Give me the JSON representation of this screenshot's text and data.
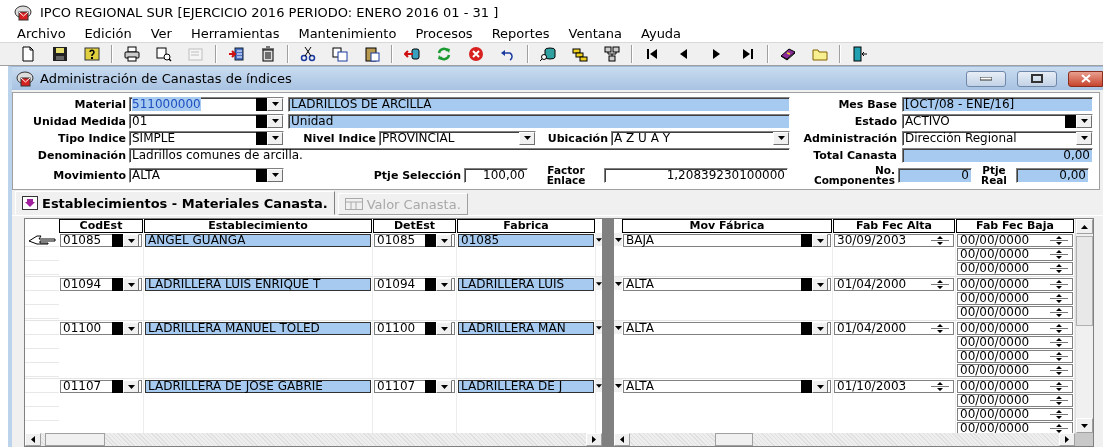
{
  "app_title": "IPCO REGIONAL SUR [EJERCICIO 2016 PERIODO: ENERO 2016 01 - 31 ]",
  "menu": [
    "Archivo",
    "Edición",
    "Ver",
    "Herramientas",
    "Mantenimiento",
    "Procesos",
    "Reportes",
    "Ventana",
    "Ayuda"
  ],
  "child_window": {
    "title": "Administración de Canastas de índices"
  },
  "form": {
    "material": {
      "label": "Material",
      "value": "511000000",
      "focused": true,
      "description": "LADRILLOS DE ARCILLA"
    },
    "unidad_medida": {
      "label": "Unidad Medida",
      "value": "01",
      "description": "Unidad"
    },
    "tipo_indice": {
      "label": "Tipo Indice",
      "value": "SIMPLE"
    },
    "nivel_indice": {
      "label": "Nivel Indice",
      "value": "PROVINCIAL"
    },
    "ubicacion": {
      "label": "Ubicación",
      "value": "A Z U A Y"
    },
    "denominacion": {
      "label": "Denominación",
      "value": "Ladrillos comunes de arcilla."
    },
    "movimiento": {
      "label": "Movimiento",
      "value": "ALTA"
    },
    "ptje_seleccion": {
      "label": "Ptje Selección",
      "value": "100,00"
    },
    "factor_enlace": {
      "label": "Factor Enlace",
      "value": "1,20839230100000"
    },
    "mes_base": {
      "label": "Mes Base",
      "value": "[OCT/08 - ENE/16]"
    },
    "estado": {
      "label": "Estado",
      "value": "ACTIVO"
    },
    "administracion": {
      "label": "Administración",
      "value": "Dirección Regional"
    },
    "total_canasta": {
      "label": "Total Canasta",
      "value": "0,00"
    },
    "no_componentes": {
      "label": "No. Componentes",
      "value": "0"
    },
    "ptje_real": {
      "label": "Ptje Real",
      "value": "0,00"
    }
  },
  "tabs": [
    {
      "label": "Establecimientos - Materiales Canasta.",
      "selected": true,
      "disabled": false
    },
    {
      "label": "Valor Canasta.",
      "selected": false,
      "disabled": true
    }
  ],
  "grid": {
    "left_columns": [
      "CodEst",
      "Establecimiento",
      "DetEst",
      "Fabrica"
    ],
    "right_columns": [
      "Mov Fábrica",
      "Fab Fec Alta",
      "Fab Fec Baja"
    ],
    "rows": [
      {
        "selected": true,
        "codest": "01085",
        "establecimiento": "ANGEL GUANGA",
        "detest": "01085",
        "fabrica": "01085",
        "mov_fabrica": "BAJA",
        "fab_fec_alta": "30/09/2003",
        "fab_fec_baja": [
          "00/00/0000",
          "00/00/0000",
          "00/00/0000"
        ]
      },
      {
        "selected": false,
        "codest": "01094",
        "establecimiento": "LADRILLERA LUIS ENRIQUE T",
        "detest": "01094",
        "fabrica": "LADRILLERA LUIS",
        "mov_fabrica": "ALTA",
        "fab_fec_alta": "01/04/2000",
        "fab_fec_baja": [
          "00/00/0000",
          "00/00/0000",
          "00/00/0000"
        ]
      },
      {
        "selected": false,
        "codest": "01100",
        "establecimiento": "LADRILLERA MANUEL TOLED",
        "detest": "01100",
        "fabrica": "LADRILLERA MAN",
        "mov_fabrica": "ALTA",
        "fab_fec_alta": "01/04/2000",
        "fab_fec_baja": [
          "00/00/0000",
          "00/00/0000",
          "00/00/0000",
          "00/00/0000"
        ]
      },
      {
        "selected": false,
        "codest": "01107",
        "establecimiento": "LADRILLERA DE JOSE GABRIE",
        "detest": "01107",
        "fabrica": "LADRILLERA DE J",
        "mov_fabrica": "ALTA",
        "fab_fec_alta": "01/10/2003",
        "fab_fec_baja": [
          "00/00/0000",
          "00/00/0000",
          "00/00/0000",
          "00/00/0000"
        ]
      }
    ]
  }
}
